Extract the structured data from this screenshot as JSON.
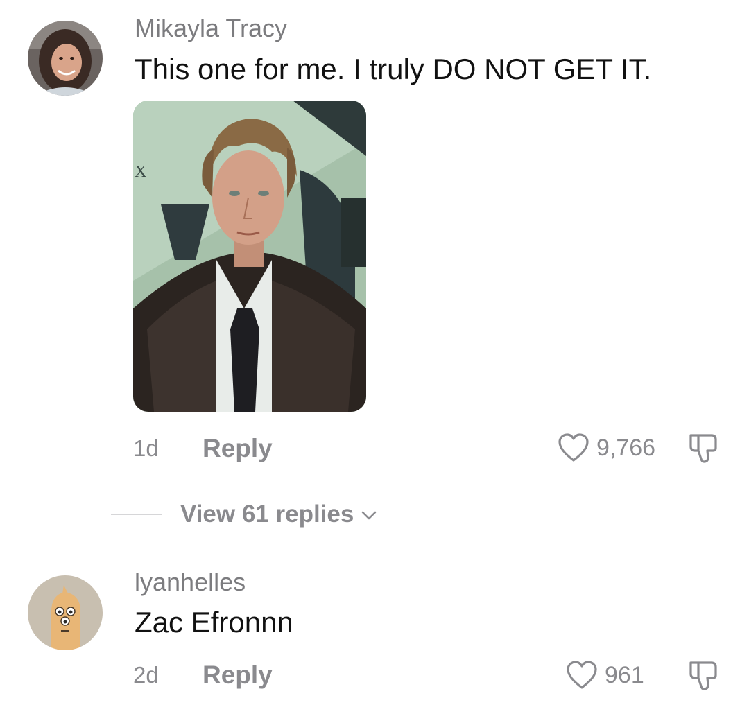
{
  "comments": [
    {
      "username": "Mikayla Tracy",
      "text": "This one for me. I truly DO NOT GET IT.",
      "time": "1d",
      "reply_label": "Reply",
      "likes": "9,766",
      "has_image": true,
      "image_text": "X"
    },
    {
      "username": "lyanhelles",
      "text": "Zac Efronnn",
      "time": "2d",
      "reply_label": "Reply",
      "likes": "961"
    }
  ],
  "view_replies": {
    "label": "View 61 replies"
  },
  "icons": {
    "like": "heart-outline-icon",
    "dislike": "thumbs-down-icon",
    "expand": "chevron-down-icon"
  },
  "colors": {
    "muted_text": "#8a8a8e",
    "username_text": "#7c7c7f",
    "body_text": "#111111",
    "divider": "#d6d6d8"
  }
}
